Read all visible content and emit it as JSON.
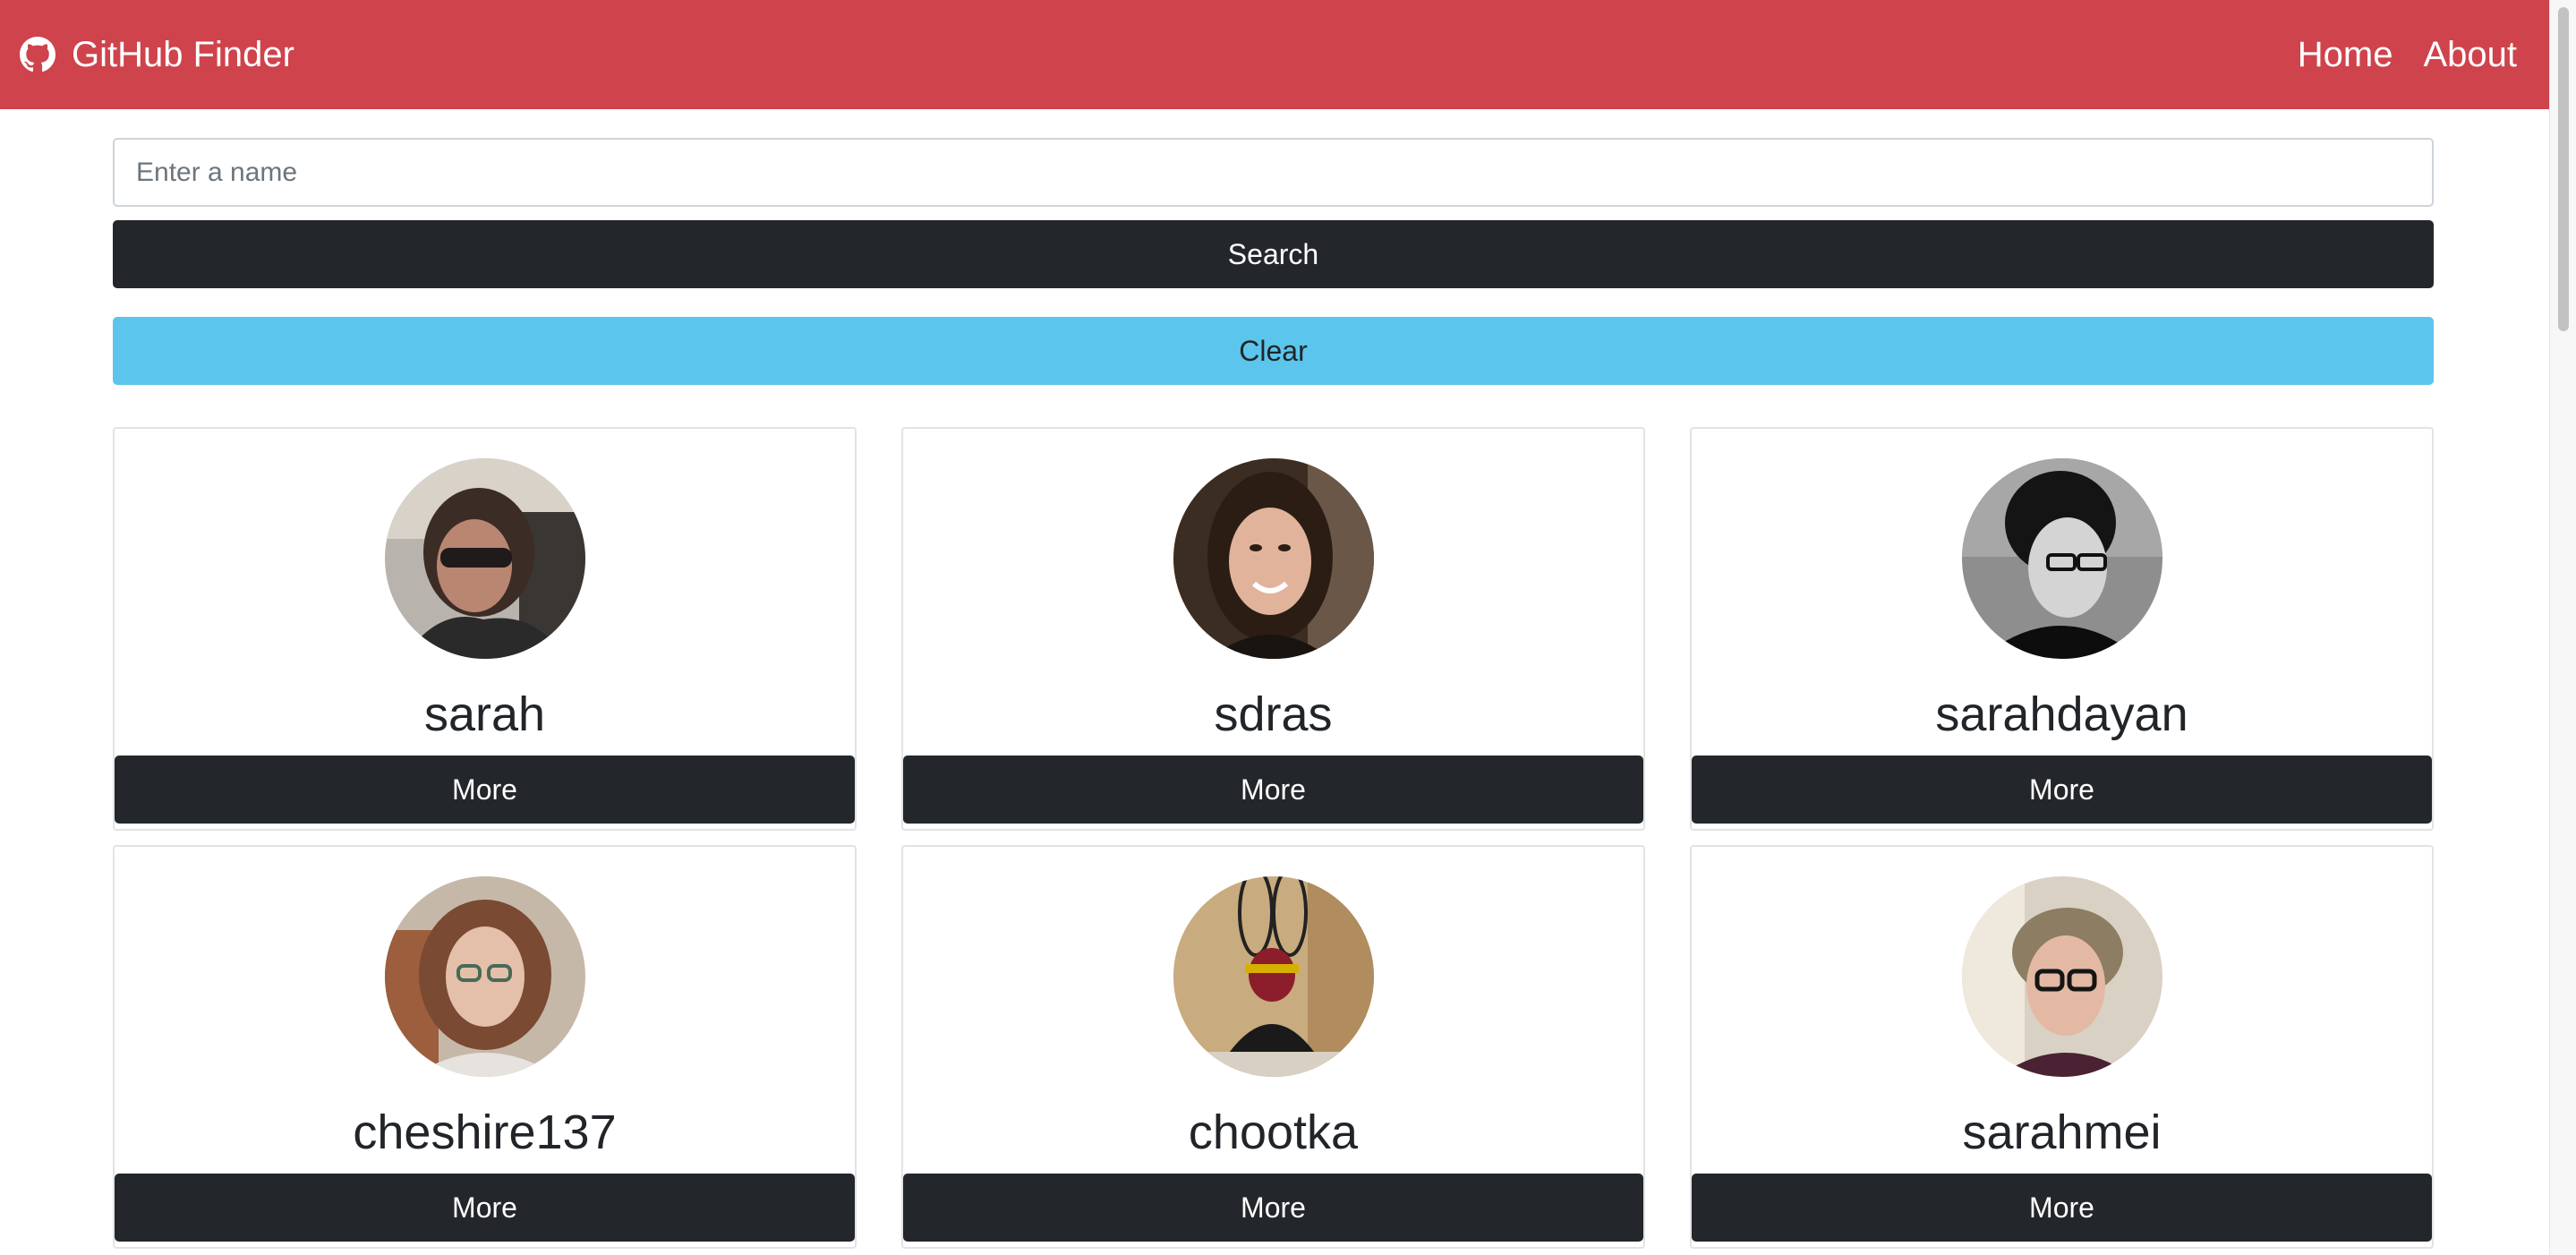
{
  "navbar": {
    "title": "GitHub Finder",
    "icon": "github-icon",
    "links": [
      "Home",
      "About"
    ],
    "color": "#cf434c"
  },
  "search": {
    "placeholder": "Enter a name",
    "value": "",
    "search_label": "Search",
    "clear_label": "Clear"
  },
  "users": [
    {
      "login": "sarah",
      "more_label": "More"
    },
    {
      "login": "sdras",
      "more_label": "More"
    },
    {
      "login": "sarahdayan",
      "more_label": "More"
    },
    {
      "login": "cheshire137",
      "more_label": "More"
    },
    {
      "login": "chootka",
      "more_label": "More"
    },
    {
      "login": "sarahmei",
      "more_label": "More"
    }
  ],
  "colors": {
    "accent": "#cf434c",
    "dark": "#23272b",
    "info": "#5bc5ec"
  }
}
